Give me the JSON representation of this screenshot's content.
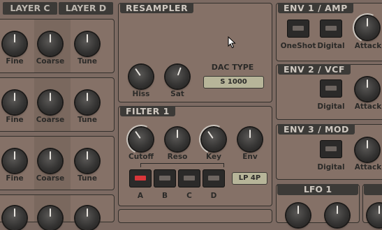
{
  "layers": {
    "tabs": [
      "LAYER C",
      "LAYER D"
    ],
    "knob_labels": [
      "Fine",
      "Coarse",
      "Tune"
    ]
  },
  "resampler": {
    "title": "RESAMPLER",
    "knobs": [
      "Hiss",
      "Sat"
    ],
    "dac_label": "DAC TYPE",
    "dac_value": "S 1000"
  },
  "filter": {
    "title": "FILTER 1",
    "knobs": [
      "Cutoff",
      "Reso",
      "Key",
      "Env"
    ],
    "mode": "LP 4P",
    "slots": [
      "A",
      "B",
      "C",
      "D"
    ]
  },
  "env1": {
    "title": "ENV 1 / AMP",
    "labels": [
      "OneShot",
      "Digital",
      "Attack"
    ]
  },
  "env2": {
    "title": "ENV 2 / VCF",
    "labels": [
      "Digital",
      "Attack"
    ]
  },
  "env3": {
    "title": "ENV 3 / MOD",
    "labels": [
      "Digital",
      "Attack"
    ]
  },
  "lfo": {
    "title": "LFO 1"
  },
  "colors": {
    "led_active": "#d9363a",
    "lcd": "#b7b599",
    "panel": "#857167"
  }
}
